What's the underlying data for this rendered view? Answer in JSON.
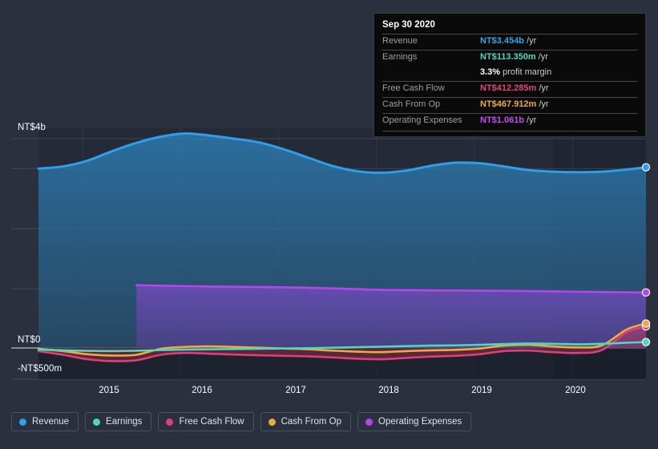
{
  "tooltip": {
    "title": "Sep 30 2020",
    "rows": [
      {
        "label": "Revenue",
        "value": "NT$3.454b",
        "suffix": "/yr",
        "color": "#3aa0e8"
      },
      {
        "label": "Earnings",
        "value": "NT$113.350m",
        "suffix": "/yr",
        "color": "#4fd8bd"
      },
      {
        "label": "",
        "value": "3.3%",
        "suffix": "profit margin",
        "color": "#ffffff"
      },
      {
        "label": "Free Cash Flow",
        "value": "NT$412.285m",
        "suffix": "/yr",
        "color": "#e8417f"
      },
      {
        "label": "Cash From Op",
        "value": "NT$467.912m",
        "suffix": "/yr",
        "color": "#eeab3d"
      },
      {
        "label": "Operating Expenses",
        "value": "NT$1.061b",
        "suffix": "/yr",
        "color": "#c44ef0"
      }
    ]
  },
  "axes": {
    "y_labels": [
      {
        "text": "NT$4b",
        "value": 4000
      },
      {
        "text": "NT$0",
        "value": 0
      },
      {
        "text": "-NT$500m",
        "value": -500
      }
    ],
    "x_labels": [
      "2015",
      "2016",
      "2017",
      "2018",
      "2019",
      "2020"
    ]
  },
  "legend": {
    "items": [
      {
        "label": "Revenue",
        "color": "#2e9fe8"
      },
      {
        "label": "Earnings",
        "color": "#4fd8bd"
      },
      {
        "label": "Free Cash Flow",
        "color": "#dd3f78"
      },
      {
        "label": "Cash From Op",
        "color": "#eeab3d"
      },
      {
        "label": "Operating Expenses",
        "color": "#b845ea"
      }
    ]
  },
  "chart_data": {
    "type": "area",
    "title": "",
    "xlabel": "",
    "ylabel": "NT$",
    "currency": "NT$",
    "units": "millions",
    "ylim": [
      -500,
      4600
    ],
    "xlim": [
      "2014.55",
      "2020.75"
    ],
    "grid": true,
    "gridlines_y": [
      4000,
      3430,
      2280,
      1130,
      0
    ],
    "legend_position": "bottom",
    "x": [
      2014.55,
      2014.8,
      2015.05,
      2015.3,
      2015.55,
      2015.8,
      2016.05,
      2016.3,
      2016.55,
      2016.8,
      2017.05,
      2017.3,
      2017.55,
      2017.8,
      2018.05,
      2018.3,
      2018.55,
      2018.8,
      2019.05,
      2019.3,
      2019.55,
      2019.8,
      2020.05,
      2020.3,
      2020.55,
      2020.75
    ],
    "series": [
      {
        "name": "Revenue",
        "color": "#2e9fe8",
        "fill": true,
        "end_value": 3454,
        "values": [
          3430,
          3470,
          3580,
          3760,
          3920,
          4040,
          4100,
          4060,
          4000,
          3930,
          3800,
          3640,
          3480,
          3380,
          3350,
          3390,
          3480,
          3540,
          3530,
          3470,
          3400,
          3370,
          3360,
          3370,
          3410,
          3454
        ]
      },
      {
        "name": "Earnings",
        "color": "#4fd8bd",
        "fill": false,
        "end_value": 113,
        "values": [
          -30,
          -45,
          -55,
          -58,
          -52,
          -40,
          -30,
          -25,
          -20,
          -15,
          -10,
          -5,
          5,
          15,
          25,
          35,
          45,
          50,
          60,
          75,
          85,
          80,
          70,
          80,
          100,
          113
        ]
      },
      {
        "name": "Free Cash Flow",
        "color": "#dd3f78",
        "fill": true,
        "end_value": 412,
        "values": [
          -60,
          -130,
          -215,
          -250,
          -235,
          -130,
          -95,
          -110,
          -125,
          -140,
          -150,
          -160,
          -180,
          -205,
          -215,
          -190,
          -165,
          -150,
          -120,
          -60,
          -50,
          -80,
          -95,
          -40,
          300,
          412
        ]
      },
      {
        "name": "Cash From Op",
        "color": "#eeab3d",
        "fill": false,
        "end_value": 468,
        "values": [
          -15,
          -60,
          -120,
          -145,
          -130,
          -15,
          20,
          30,
          20,
          5,
          -10,
          -25,
          -50,
          -70,
          -80,
          -60,
          -45,
          -35,
          -10,
          45,
          60,
          30,
          10,
          50,
          350,
          468
        ]
      },
      {
        "name": "Operating Expenses",
        "color": "#b845ea",
        "fill": true,
        "start_x": 2015.55,
        "end_value": 1061,
        "values": [
          null,
          null,
          null,
          null,
          1200,
          1190,
          1182,
          1176,
          1170,
          1165,
          1160,
          1152,
          1140,
          1125,
          1110,
          1105,
          1100,
          1098,
          1095,
          1092,
          1088,
          1082,
          1076,
          1070,
          1065,
          1061
        ]
      }
    ]
  }
}
